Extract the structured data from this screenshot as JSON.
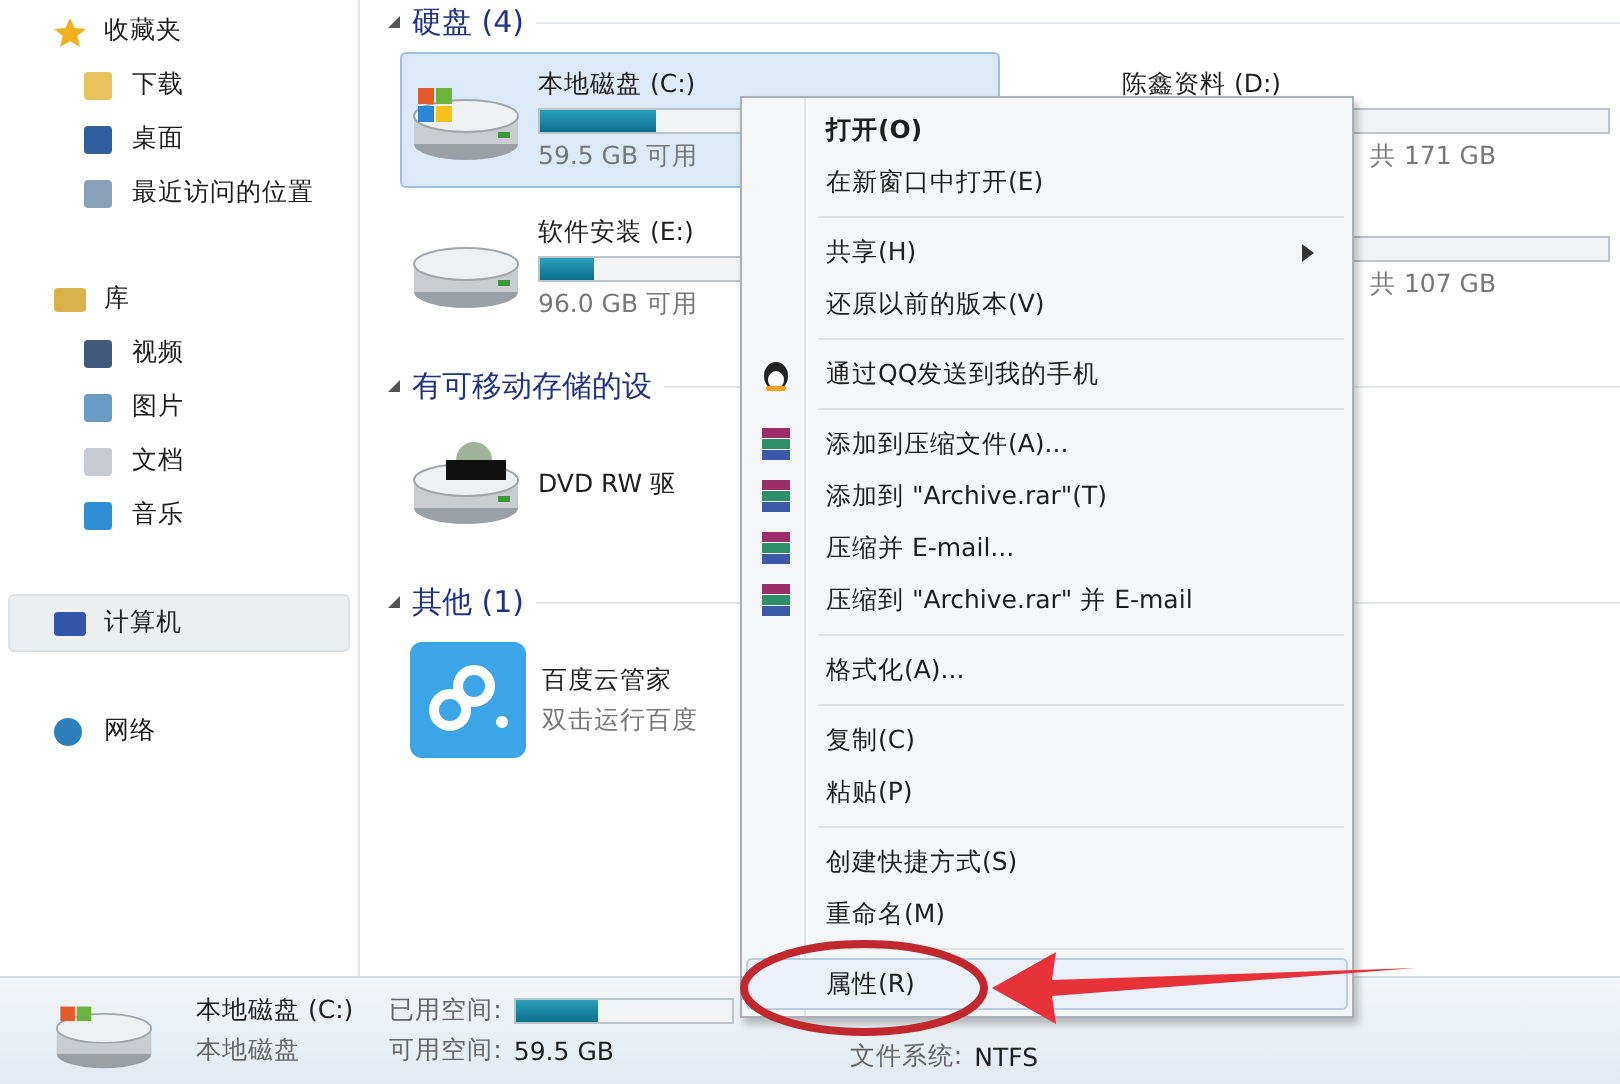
{
  "sidebar": {
    "sections": [
      {
        "label": "收藏夹",
        "kind": "star",
        "selected": false,
        "children": [
          {
            "label": "下载",
            "kind": "download",
            "selected": false
          },
          {
            "label": "桌面",
            "kind": "desktop",
            "selected": false
          },
          {
            "label": "最近访问的位置",
            "kind": "recent",
            "selected": false
          }
        ]
      },
      {
        "label": "库",
        "kind": "library",
        "selected": false,
        "children": [
          {
            "label": "视频",
            "kind": "video",
            "selected": false
          },
          {
            "label": "图片",
            "kind": "picture",
            "selected": false
          },
          {
            "label": "文档",
            "kind": "document",
            "selected": false
          },
          {
            "label": "音乐",
            "kind": "music",
            "selected": false
          }
        ]
      },
      {
        "label": "计算机",
        "kind": "computer",
        "selected": true
      },
      {
        "label": "网络",
        "kind": "network",
        "selected": false
      }
    ]
  },
  "groups": [
    {
      "title": "硬盘 (4)",
      "items": [
        {
          "kind": "system-drive",
          "name": "本地磁盘 (C:)",
          "level": 0.26,
          "free": "59.5 GB 可用",
          "selected": true
        },
        {
          "kind": "drive-right",
          "name": "陈鑫资料 (D:)",
          "free": "共 171 GB",
          "selected": false
        },
        {
          "kind": "drive",
          "name": "软件安装 (E:)",
          "level": 0.12,
          "free": "96.0 GB 可用",
          "selected": false
        },
        {
          "kind": "drive-right",
          "free": "共 107 GB",
          "selected": false
        }
      ]
    },
    {
      "title": "有可移动存储的设",
      "items": [
        {
          "kind": "dvd",
          "name": "DVD RW 驱",
          "selected": false
        }
      ]
    },
    {
      "title": "其他 (1)",
      "items": [
        {
          "kind": "app",
          "name": "百度云管家",
          "sub": "双击运行百度",
          "selected": false
        }
      ]
    }
  ],
  "menu": [
    {
      "label": "打开(O)",
      "kind": "default",
      "highlighted": false
    },
    {
      "label": "在新窗口中打开(E)",
      "kind": "plain",
      "highlighted": false
    },
    {
      "kind": "separator"
    },
    {
      "label": "共享(H)",
      "kind": "submenu",
      "highlighted": false
    },
    {
      "label": "还原以前的版本(V)",
      "kind": "plain",
      "highlighted": false
    },
    {
      "kind": "separator"
    },
    {
      "label": "通过QQ发送到我的手机",
      "kind": "qq",
      "highlighted": false
    },
    {
      "kind": "separator"
    },
    {
      "label": "添加到压缩文件(A)...",
      "kind": "archive",
      "highlighted": false
    },
    {
      "label": "添加到 \"Archive.rar\"(T)",
      "kind": "archive",
      "highlighted": false
    },
    {
      "label": "压缩并 E-mail...",
      "kind": "archive",
      "highlighted": false
    },
    {
      "label": "压缩到 \"Archive.rar\" 并 E-mail",
      "kind": "archive",
      "highlighted": false
    },
    {
      "kind": "separator"
    },
    {
      "label": "格式化(A)...",
      "kind": "plain",
      "highlighted": false
    },
    {
      "kind": "separator"
    },
    {
      "label": "复制(C)",
      "kind": "plain",
      "highlighted": false
    },
    {
      "label": "粘贴(P)",
      "kind": "plain",
      "highlighted": false
    },
    {
      "kind": "separator"
    },
    {
      "label": "创建快捷方式(S)",
      "kind": "plain",
      "highlighted": false
    },
    {
      "label": "重命名(M)",
      "kind": "plain",
      "highlighted": false
    },
    {
      "kind": "separator"
    },
    {
      "label": "属性(R)",
      "kind": "plain",
      "highlighted": true
    }
  ],
  "details": {
    "name": "本地磁盘 (C:)",
    "type": "本地磁盘",
    "used_label": "已用空间:",
    "level": 0.38,
    "free_label": "可用空间:",
    "free": "59.5 GB",
    "fs_label": "文件系统:",
    "fs": "NTFS"
  }
}
